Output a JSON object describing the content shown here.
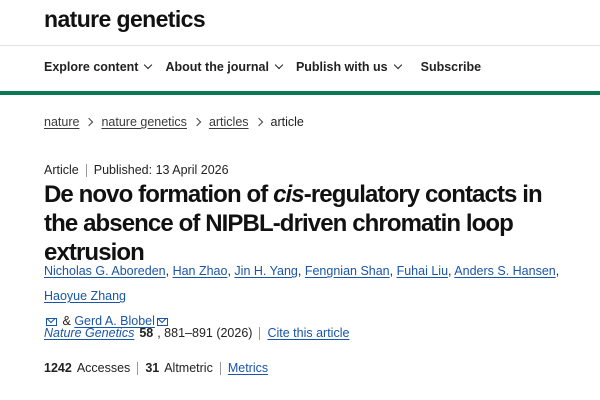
{
  "logo": {
    "part1": "nature",
    "part2": "genetics"
  },
  "nav": {
    "items": [
      {
        "label": "Explore content"
      },
      {
        "label": "About the journal"
      },
      {
        "label": "Publish with us"
      }
    ],
    "subscribe": "Subscribe"
  },
  "colors": {
    "brand_green": "#0a7a55",
    "link_blue": "#1a55a7"
  },
  "breadcrumb": [
    "nature",
    "nature genetics",
    "articles",
    "article"
  ],
  "article": {
    "type": "Article",
    "published": "Published: 13 April 2026",
    "title_part1": "De novo formation of ",
    "title_italic": "cis",
    "title_part2": "-regulatory contacts in the absence of NIPBL-driven chromatin loop extrusion"
  },
  "authors": {
    "list": [
      "Nicholas G. Aboreden",
      "Han Zhao",
      "Jin H. Yang",
      "Fengnian Shan",
      "Fuhai Liu",
      "Anders S. Hansen",
      "Haoyue Zhang"
    ],
    "amp": "&",
    "last": "Gerd A. Blobel"
  },
  "citation": {
    "journal": "Nature Genetics",
    "volume": "58",
    "pages_year": ", 881–891 (2026)",
    "cite_link": "Cite this article"
  },
  "stats": {
    "accesses_count": "1242",
    "accesses_label": "Accesses",
    "altmetric_count": "31",
    "altmetric_label": "Altmetric",
    "metrics_link": "Metrics"
  }
}
